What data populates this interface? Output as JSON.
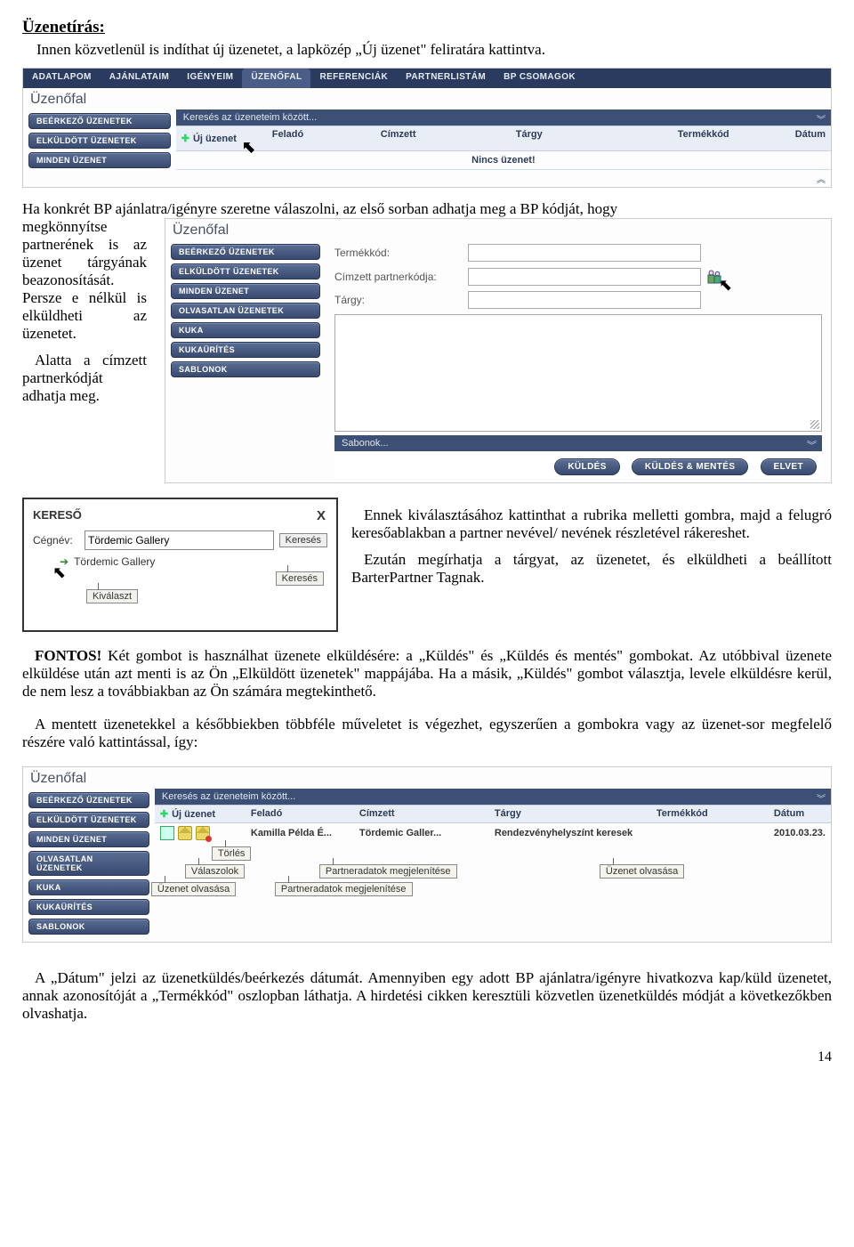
{
  "doc": {
    "title": "Üzenetírás:",
    "intro": "Innen közvetlenül is indíthat új üzenetet, a lapközép „Új üzenet\" feliratára kattintva.",
    "page_number": "14"
  },
  "shot1": {
    "topnav": [
      "ADATLAPOM",
      "AJÁNLATAIM",
      "IGÉNYEIM",
      "ÜZENŐFAL",
      "REFERENCIÁK",
      "PARTNERLISTÁM",
      "BP CSOMAGOK"
    ],
    "topnav_active": 3,
    "panel_title": "Üzenőfal",
    "sidebar": [
      "BEÉRKEZŐ ÜZENETEK",
      "ELKÜLDÖTT ÜZENETEK",
      "MINDEN ÜZENET"
    ],
    "search_placeholder": "Keresés az üzeneteim között...",
    "columns": {
      "uj": "Új üzenet",
      "felado": "Feladó",
      "cimzett": "Címzett",
      "targy": "Tárgy",
      "termek": "Termékkód",
      "datum": "Dátum"
    },
    "empty": "Nincs üzenet!"
  },
  "para_left": {
    "p1a": "Ha konkrét BP ajánlatra/igényre szeretne válaszolni, az első sorban adhatja meg a BP kódját, hogy",
    "p1b": "megkönnyítse partnerének is az üzenet tárgyának beazonosítását. Persze e nélkül is elküldheti az üzenetet.",
    "p2": "Alatta a címzett partnerkódját adhatja meg."
  },
  "shot2": {
    "panel_title": "Üzenőfal",
    "sidebar": [
      "BEÉRKEZŐ ÜZENETEK",
      "ELKÜLDÖTT ÜZENETEK",
      "MINDEN ÜZENET",
      "OLVASATLAN ÜZENETEK",
      "KUKA",
      "KUKAÜRÍTÉS",
      "SABLONOK"
    ],
    "labels": {
      "termek": "Termékkód:",
      "cimzett": "Címzett partnerkódja:",
      "targy": "Tárgy:"
    },
    "sabonok": "Sabonok...",
    "buttons": {
      "kuldes": "KÜLDÉS",
      "kuldesmentes": "KÜLDÉS & MENTÉS",
      "elvet": "ELVET"
    }
  },
  "kereso": {
    "title": "KERESŐ",
    "label_cegnev": "Cégnév:",
    "value_cegnev": "Tördemic Gallery",
    "btn": "Keresés",
    "hit": "Tördemic Gallery",
    "kivalaszt": "Kiválaszt"
  },
  "para_right": {
    "p1": "Ennek kiválasztásához kattinthat a rubrika melletti gombra, majd a felugró keresőablakban a partner nevével/ nevének részletével rákereshet.",
    "p2": "Ezután megírhatja a tárgyat, az üzenetet, és elküldheti a beállított BarterPartner Tagnak."
  },
  "fontos": {
    "label": "FONTOS!",
    "rest1": " Két gombot is használhat üzenete elküldésére: a „Küldés\" és „Küldés és mentés\" gombokat. Az utóbbival üzenete elküldése után azt menti is az Ön „Elküldött üzenetek\" mappájába. Ha a másik, „Küldés\" gombot választja, levele elküldésre kerül, de nem lesz a továbbiakban az Ön számára megtekinthető.",
    "p2": "A mentett üzenetekkel a későbbiekben többféle műveletet is végezhet, egyszerűen a gombokra vagy az üzenet-sor megfelelő részére való kattintással, így:"
  },
  "shot3": {
    "panel_title": "Üzenőfal",
    "sidebar": [
      "BEÉRKEZŐ ÜZENETEK",
      "ELKÜLDÖTT ÜZENETEK",
      "MINDEN ÜZENET",
      "OLVASATLAN ÜZENETEK",
      "KUKA",
      "KUKAÜRÍTÉS",
      "SABLONOK"
    ],
    "search_placeholder": "Keresés az üzeneteim között...",
    "columns": {
      "uj": "Új üzenet",
      "felado": "Feladó",
      "cimzett": "Címzett",
      "targy": "Tárgy",
      "termek": "Termékkód",
      "datum": "Dátum"
    },
    "row": {
      "felado": "Kamilla Példa É...",
      "cimzett": "Tördemic Galler...",
      "targy": "Rendezvényhelyszínt keresek",
      "termek": "",
      "datum": "2010.03.23."
    },
    "tooltips": {
      "uzenet_olvasasa": "Üzenet olvasása",
      "torles": "Törlés",
      "valaszolok": "Válaszolok",
      "partneradatok": "Partneradatok megjelenítése"
    }
  },
  "trailer": {
    "p": "A „Dátum\" jelzi az üzenetküldés/beérkezés dátumát. Amennyiben egy adott BP ajánlatra/igényre hivatkozva kap/küld üzenetet, annak azonosítóját a „Termékkód\" oszlopban láthatja. A hirdetési cikken keresztüli közvetlen üzenetküldés módját a következőkben olvashatja."
  }
}
